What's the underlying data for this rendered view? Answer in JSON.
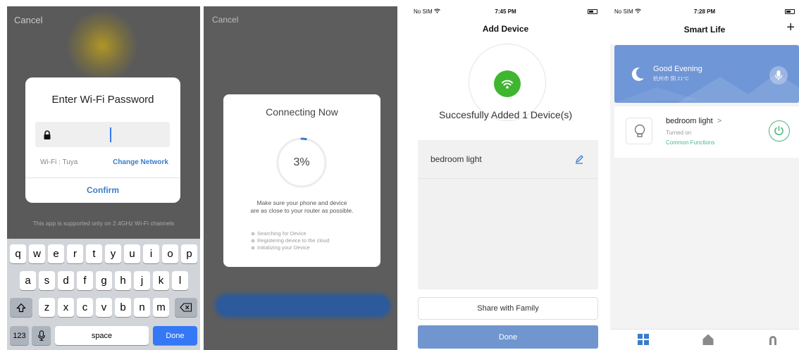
{
  "panel1": {
    "cancel": "Cancel",
    "dialog": {
      "title": "Enter Wi-Fi Password",
      "wifi_label": "Wi-Fi : Tuya",
      "change_network": "Change Network",
      "confirm": "Confirm"
    },
    "notice": "This app is supported only on 2.4GHz Wi-Fi channels",
    "keyboard": {
      "row1": [
        "q",
        "w",
        "e",
        "r",
        "t",
        "y",
        "u",
        "i",
        "o",
        "p"
      ],
      "row2": [
        "a",
        "s",
        "d",
        "f",
        "g",
        "h",
        "j",
        "k",
        "l"
      ],
      "row3": [
        "z",
        "x",
        "c",
        "v",
        "b",
        "n",
        "m"
      ],
      "numbers": "123",
      "space": "space",
      "done": "Done"
    }
  },
  "panel2": {
    "cancel": "Cancel",
    "title": "Connecting Now",
    "progress_label": "3%",
    "progress": 0.03,
    "hint_line1": "Make sure your phone and device",
    "hint_line2": "are as close to your router as possible.",
    "steps": [
      "Searching for Device",
      "Registering device to the cloud",
      "Initializing your Device"
    ]
  },
  "panel3": {
    "status": {
      "carrier": "No SIM",
      "time": "7:45 PM"
    },
    "title": "Add Device",
    "success": "Succesfully Added 1 Device(s)",
    "device_name": "bedroom light",
    "share": "Share with Family",
    "done": "Done"
  },
  "panel4": {
    "status": {
      "carrier": "No SIM",
      "time": "7:28 PM"
    },
    "title": "Smart Life",
    "plus": "+",
    "greeting": "Good Evening",
    "weather": "杭州市 阴 21°C",
    "device_name": "bedroom light",
    "chevron": ">",
    "device_state": "Turned on",
    "common_functions": "Common Functions"
  },
  "colors": {
    "ios_blue": "#3478f6",
    "link_blue": "#3b7dc9",
    "success_green": "#3fb62f",
    "tuya_blue": "#6f96d6",
    "power_green": "#46b67a"
  }
}
